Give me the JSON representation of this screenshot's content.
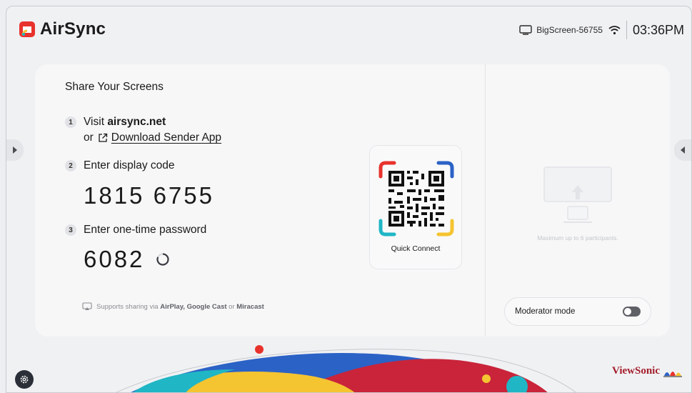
{
  "app": {
    "name": "AirSync"
  },
  "status_bar": {
    "device_name": "BigScreen-56755",
    "time": "03:36PM"
  },
  "main": {
    "title": "Share Your Screens",
    "steps": [
      {
        "num": "1",
        "prefix": "Visit ",
        "emph": "airsync.net"
      },
      {
        "num": "2",
        "text": "Enter display code"
      },
      {
        "num": "3",
        "text": "Enter one-time password"
      }
    ],
    "or_label": "or",
    "download_link": "Download Sender App",
    "display_code": "1815 6755",
    "otp": "6082",
    "supports": {
      "prefix": "Supports sharing via",
      "first": "AirPlay, Google Cast",
      "joiner": "or",
      "last": "Miracast"
    }
  },
  "qr": {
    "label": "Quick Connect"
  },
  "side_panel": {
    "max_text": "Maximum up to 6 participants.",
    "moderator_label": "Moderator mode",
    "moderator_enabled": false
  },
  "footer": {
    "brand": "ViewSonic"
  },
  "colors": {
    "brand_red": "#a31d2a",
    "toggle_off": "#5f6166",
    "qr_red": "#e8322c",
    "qr_blue": "#2b62c6",
    "qr_teal": "#20b6c5",
    "qr_yellow": "#f5c431"
  }
}
